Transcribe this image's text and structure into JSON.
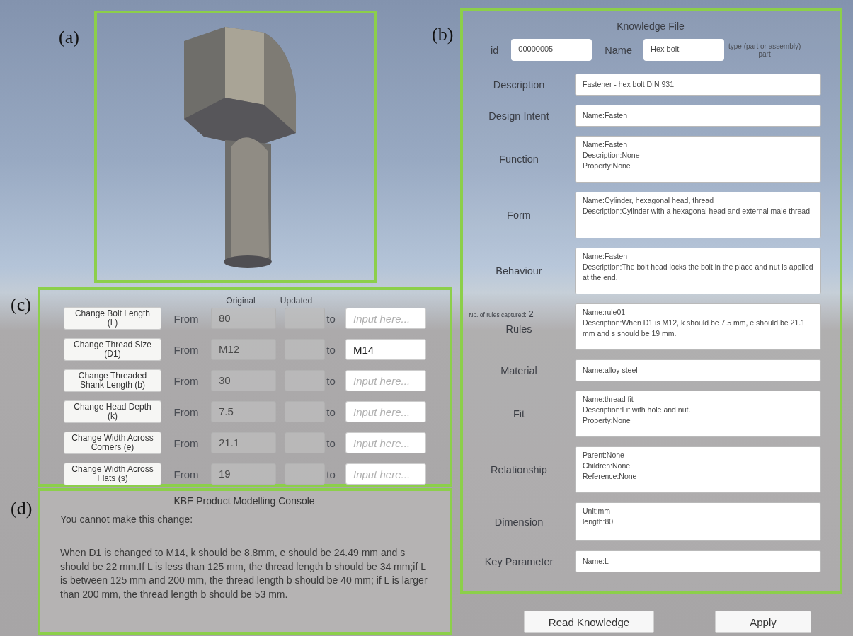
{
  "figure_labels": [
    "(a)",
    "(b)",
    "(c)",
    "(d)"
  ],
  "parameters": {
    "columns": [
      "Original",
      "Updated"
    ],
    "rows": [
      {
        "button": "Change Bolt Length\n(L)",
        "from": "From",
        "original": "80",
        "to": "to",
        "placeholder": "Input here..."
      },
      {
        "button": "Change Thread Size\n(D1)",
        "from": "From",
        "original": "M12",
        "to": "to",
        "value": "M14"
      },
      {
        "button": "Change Threaded\nShank Length (b)",
        "from": "From",
        "original": "30",
        "to": "to",
        "placeholder": "Input here..."
      },
      {
        "button": "Change Head Depth\n(k)",
        "from": "From",
        "original": "7.5",
        "to": "to",
        "placeholder": "Input here..."
      },
      {
        "button": "Change Width Across\nCorners (e)",
        "from": "From",
        "original": "21.1",
        "to": "to",
        "placeholder": "Input here..."
      },
      {
        "button": "Change Width Across\nFlats (s)",
        "from": "From",
        "original": "19",
        "to": "to",
        "placeholder": "Input here..."
      }
    ]
  },
  "console": {
    "title": "KBE Product Modelling Console",
    "message": "You cannot make this change:",
    "detail": "When D1 is changed to M14, k should be 8.8mm, e should be 24.49 mm and s should be 22 mm.If L is less than 125 mm, the thread length b should be 34 mm;if L is between 125 mm and 200 mm, the thread length b should be 40 mm; if L is larger than 200 mm, the thread length b should be 53 mm."
  },
  "knowledge_file": {
    "title": "Knowledge File",
    "id": {
      "label": "id",
      "value": "00000005"
    },
    "name": {
      "label": "Name",
      "value": "Hex bolt"
    },
    "type": {
      "label": "type (part or assembly)",
      "value": "part"
    },
    "fields": [
      {
        "label": "Description",
        "kind": "single",
        "value": "Fastener - hex bolt DIN 931"
      },
      {
        "label": "Design Intent",
        "kind": "single",
        "value": "Name:Fasten"
      },
      {
        "label": "Function",
        "kind": "multi",
        "value": "Name:Fasten\nDescription:None\nProperty:None"
      },
      {
        "label": "Form",
        "kind": "multi",
        "value": "Name:Cylinder, hexagonal head, thread\nDescription:Cylinder with a hexagonal head and external male thread"
      },
      {
        "label": "Behaviour",
        "kind": "multi",
        "value": "Name:Fasten\nDescription:The bolt head locks the bolt in the place and nut is applied at the end."
      },
      {
        "label": "Rules",
        "kind": "multi",
        "count_label": "No. of rules captured:",
        "count": "2",
        "value": "Name:rule01\nDescription:When D1 is M12, k should be 7.5 mm, e should be 21.1 mm and s should be 19 mm."
      },
      {
        "label": "Material",
        "kind": "single",
        "value": "Name:alloy steel"
      },
      {
        "label": "Fit",
        "kind": "multi",
        "value": "Name:thread fit\nDescription:Fit with hole and nut.\nProperty:None"
      },
      {
        "label": "Relationship",
        "kind": "multi",
        "value": "Parent:None\nChildren:None\nReference:None"
      },
      {
        "label": "Dimension",
        "kind": "short",
        "value": "Unit:mm\nlength:80"
      },
      {
        "label": "Key Parameter",
        "kind": "single",
        "value": "Name:L"
      }
    ]
  },
  "buttons": [
    "Read Knowledge",
    "Apply"
  ]
}
